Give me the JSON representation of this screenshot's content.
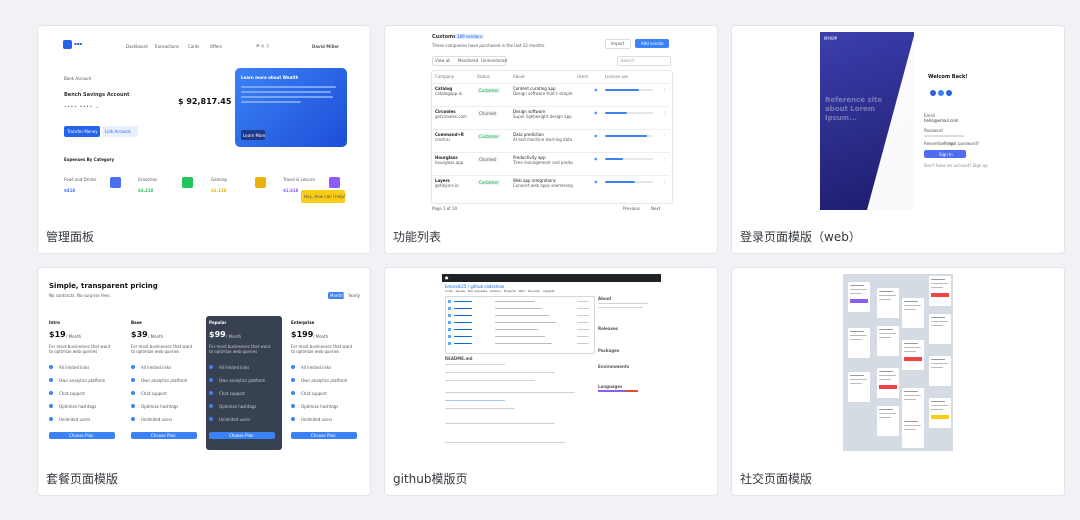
{
  "cards": [
    {
      "title": "管理面板"
    },
    {
      "title": "功能列表"
    },
    {
      "title": "登录页面模版（web）"
    },
    {
      "title": "套餐页面模版"
    },
    {
      "title": "github模版页"
    },
    {
      "title": "社交页面模版"
    }
  ],
  "admin": {
    "nav": [
      "Dashboard",
      "Transactions",
      "Cards",
      "Offers"
    ],
    "user": "David Miller",
    "account_label": "Bank Account",
    "balance": "$ 92,817.45",
    "account_name": "Bench Savings Account",
    "promo_title": "Learn more about Wealth",
    "transfer_button": "Transfer Money",
    "link_button": "Link Account",
    "promo_button": "Learn More",
    "expenses_heading": "Expenses By Category",
    "categories": [
      {
        "name": "Food and Drinks",
        "amount": "$418",
        "color": "#4b6ef5"
      },
      {
        "name": "Groceries",
        "amount": "$3,218",
        "color": "#22c55e"
      },
      {
        "name": "Gaming",
        "amount": "$1,128",
        "color": "#eab308"
      },
      {
        "name": "Travel & Leisure",
        "amount": "$1,818",
        "color": "#8b5cf6"
      }
    ],
    "chat_label": "Hey, How can I help?"
  },
  "features": {
    "title": "Customers",
    "badge": "189 vendors",
    "subtitle": "These companies have purchased in the last 12 months.",
    "import": "Import",
    "add": "Add vendor",
    "tabs": [
      "View all",
      "Monitored",
      "Unmonitored"
    ],
    "search": "Search",
    "columns": [
      "Company",
      "Status",
      "About",
      "Users",
      "License use"
    ],
    "rows": [
      {
        "company": "Catalog",
        "site": "catalogapp.io",
        "status": "Customer",
        "about": "Content curating app",
        "detail": "Design software that's simple & smart"
      },
      {
        "company": "Circooles",
        "site": "getcirooles.com",
        "status": "Churned",
        "about": "Design software",
        "detail": "Super lightweight design app"
      },
      {
        "company": "Command+R",
        "site": "cmdr.ai",
        "status": "Customer",
        "about": "Data prediction",
        "detail": "AI and machine learning data"
      },
      {
        "company": "Hourglass",
        "site": "hourglass.app",
        "status": "Churned",
        "about": "Productivity app",
        "detail": "Time management and productivity"
      },
      {
        "company": "Layers",
        "site": "getlayers.io",
        "status": "Customer",
        "about": "Web app integrations",
        "detail": "Connect web apps seamlessly"
      }
    ],
    "page": "Page 1 of 10",
    "prev": "Previous",
    "next": "Next"
  },
  "login": {
    "hero_text": "Reference site about Lorem Ipsum...",
    "welcome": "Welcom Back!",
    "email_label": "Email",
    "email_value": "hello@email.com",
    "password_label": "Password",
    "remember": "Remember me",
    "forgot": "Forgot password?",
    "button": "Sign In",
    "signup": "Don't have an account? Sign up",
    "brand": "MYAPP"
  },
  "pricing": {
    "title": "Simple, transparent pricing",
    "subtitle": "No contracts. No surprise fees.",
    "toggle_a": "Monthly",
    "toggle_b": "Yearly",
    "plans": [
      {
        "name": "Intro",
        "price": "$19",
        "per": "/ Month",
        "dark": false
      },
      {
        "name": "Base",
        "price": "$39",
        "per": "/ Month",
        "dark": false
      },
      {
        "name": "Popular",
        "price": "$99",
        "per": "/ Month",
        "dark": true
      },
      {
        "name": "Enterprise",
        "price": "$199",
        "per": "/ Month",
        "dark": false
      }
    ],
    "desc": "For most businesses that want to optimize web queries",
    "features": [
      "All limited links",
      "Own analytics platform",
      "Chat support",
      "Optimize hashtags",
      "Unlimited users"
    ],
    "button": "Choose Plan"
  },
  "github": {
    "repo": "bmorelli25 / github-slideshow",
    "tabs": [
      "Code",
      "Issues",
      "Pull requests",
      "Actions",
      "Projects",
      "Wiki",
      "Security",
      "Insights"
    ],
    "about": "About",
    "readme": "README.md",
    "sections": [
      "Releases",
      "Packages",
      "Environments",
      "Languages"
    ]
  },
  "social": {
    "feed": [
      "Post",
      "Post",
      "Post",
      "Post",
      "Post"
    ]
  }
}
